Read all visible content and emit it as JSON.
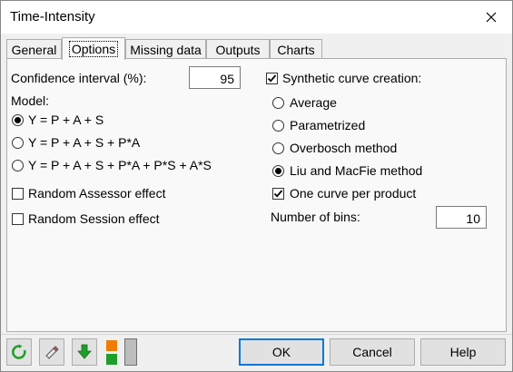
{
  "window": {
    "title": "Time-Intensity",
    "close_icon": "close-icon"
  },
  "tabs": [
    {
      "label": "General",
      "active": false
    },
    {
      "label": "Options",
      "active": true
    },
    {
      "label": "Missing data",
      "active": false
    },
    {
      "label": "Outputs",
      "active": false
    },
    {
      "label": "Charts",
      "active": false
    }
  ],
  "options": {
    "confidence_interval": {
      "label": "Confidence interval (%):",
      "value": "95"
    },
    "model": {
      "label": "Model:",
      "choices": [
        {
          "label": "Y = P + A + S",
          "selected": true
        },
        {
          "label": "Y = P + A + S + P*A",
          "selected": false
        },
        {
          "label": "Y = P + A + S + P*A + P*S + A*S",
          "selected": false
        }
      ]
    },
    "random_assessor": {
      "label": "Random Assessor effect",
      "checked": false
    },
    "random_session": {
      "label": "Random Session effect",
      "checked": false
    },
    "synthetic_curve": {
      "label": "Synthetic curve creation:",
      "checked": true
    },
    "curve_methods": [
      {
        "label": "Average",
        "selected": false
      },
      {
        "label": "Parametrized",
        "selected": false
      },
      {
        "label": "Overbosch method",
        "selected": false
      },
      {
        "label": "Liu and MacFie method",
        "selected": true
      }
    ],
    "one_curve_per_product": {
      "label": "One curve per product",
      "checked": true
    },
    "number_of_bins": {
      "label": "Number of bins:",
      "value": "10"
    }
  },
  "toolbar": {
    "icons": [
      "refresh-icon",
      "eraser-icon",
      "download-arrow-icon",
      "color-swatch-icon"
    ]
  },
  "buttons": {
    "ok": "OK",
    "cancel": "Cancel",
    "help": "Help"
  },
  "colors": {
    "accent": "#0078d7",
    "green": "#1e9e2a",
    "orange": "#f07d00"
  }
}
